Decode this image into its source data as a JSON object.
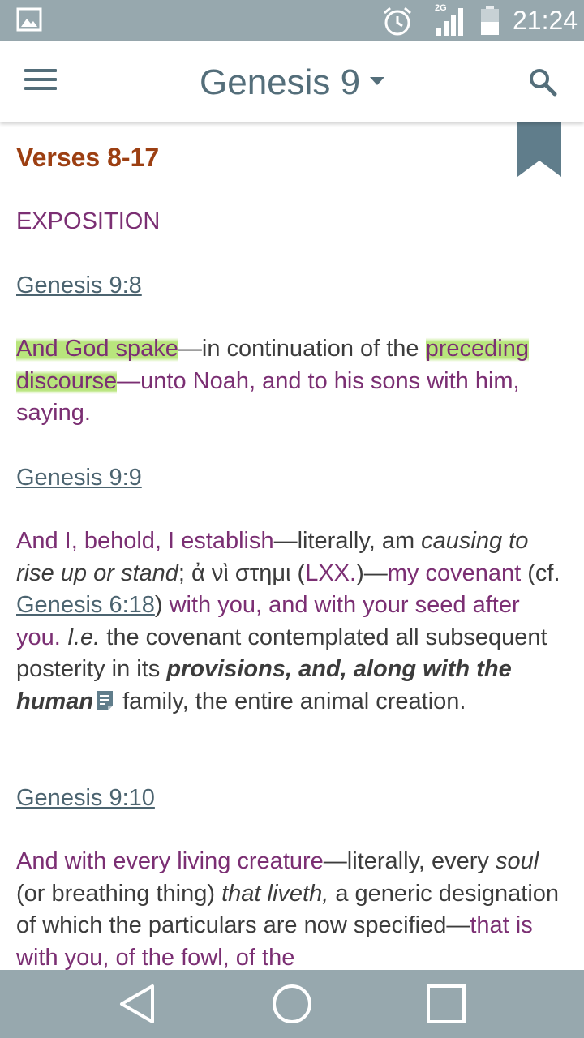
{
  "status_bar": {
    "time": "21:24",
    "network_label": "2G",
    "icons": [
      "image-notification-icon",
      "alarm-icon",
      "signal-icon",
      "battery-icon"
    ]
  },
  "app_bar": {
    "title": "Genesis 9",
    "icons": [
      "menu-icon",
      "dropdown-caret-icon",
      "search-icon"
    ]
  },
  "content": {
    "verses_heading": "Verses 8-17",
    "section_label": "EXPOSITION",
    "refs": [
      "Genesis 9:8",
      "Genesis 9:9",
      "Genesis 9:10"
    ],
    "p1": {
      "hl1": "And God spake",
      "t1": "—in continuation of the",
      "hl2": "preceding discourse",
      "t2": "—unto Noah, and to his sons with him, saying."
    },
    "p2": {
      "a": "And I, behold, I establish",
      "b": "—literally, am ",
      "c": "causing to rise up or stand",
      "d": "; ",
      "greek": "ἀ νὶ στημι",
      "e": " (",
      "lxx": "LXX.",
      "f": ")—",
      "g": "my covenant",
      "h": " (cf. ",
      "link": "Genesis 6:18",
      "i": ") ",
      "j": "with you, and with your seed after you.",
      "k": " ",
      "ie": "I.e.",
      "l": " the covenant contemplated all subsequent posterity in its ",
      "bold": "provisions, and, along with the human",
      "m": " family, the entire animal creation."
    },
    "p3": {
      "a": "And with every living creature",
      "b": "—literally, every ",
      "c": "soul",
      "d": " (or breathing thing) ",
      "e": "that liveth,",
      "f": " a generic designation of which the particulars are now specified—",
      "g": "that is with you, of the fowl, of the"
    }
  },
  "nav_bar": {
    "icons": [
      "back-icon",
      "home-icon",
      "recents-icon"
    ]
  },
  "colors": {
    "status_bar": "#97a8ae",
    "title": "#546e7a",
    "heading": "#9c3f12",
    "scripture": "#7b2f73",
    "link": "#4c6470",
    "highlight": "#a0dc50"
  }
}
